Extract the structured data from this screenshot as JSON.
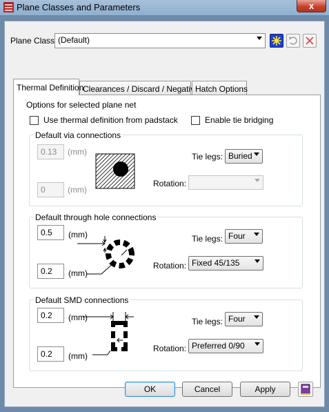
{
  "window": {
    "title": "Plane Classes and Parameters",
    "close_symbol": "x"
  },
  "plane_class": {
    "label": "Plane Class:",
    "value": "(Default)"
  },
  "tabs": [
    {
      "label": "Thermal Definition",
      "active": true
    },
    {
      "label": "Clearances / Discard / Negative",
      "active": false
    },
    {
      "label": "Hatch Options",
      "active": false
    }
  ],
  "options": {
    "title": "Options for selected plane net",
    "use_padstack_label": "Use thermal definition from padstack",
    "use_padstack_checked": false,
    "tie_bridging_label": "Enable tie bridging",
    "tie_bridging_checked": false
  },
  "via": {
    "title": "Default via connections",
    "value1": "0.13",
    "value2": "0",
    "unit": "(mm)",
    "tie_legs_label": "Tie legs:",
    "tie_legs_value": "Buried",
    "rotation_label": "Rotation:",
    "rotation_value": ""
  },
  "through": {
    "title": "Default through hole connections",
    "value1": "0.5",
    "value2": "0.2",
    "unit": "(mm)",
    "tie_legs_label": "Tie legs:",
    "tie_legs_value": "Four",
    "rotation_label": "Rotation:",
    "rotation_value": "Fixed 45/135"
  },
  "smd": {
    "title": "Default SMD connections",
    "value1": "0.2",
    "value2": "0.2",
    "unit": "(mm)",
    "tie_legs_label": "Tie legs:",
    "tie_legs_value": "Four",
    "rotation_label": "Rotation:",
    "rotation_value": "Preferred 0/90"
  },
  "buttons": {
    "ok": "OK",
    "cancel": "Cancel",
    "apply": "Apply"
  }
}
